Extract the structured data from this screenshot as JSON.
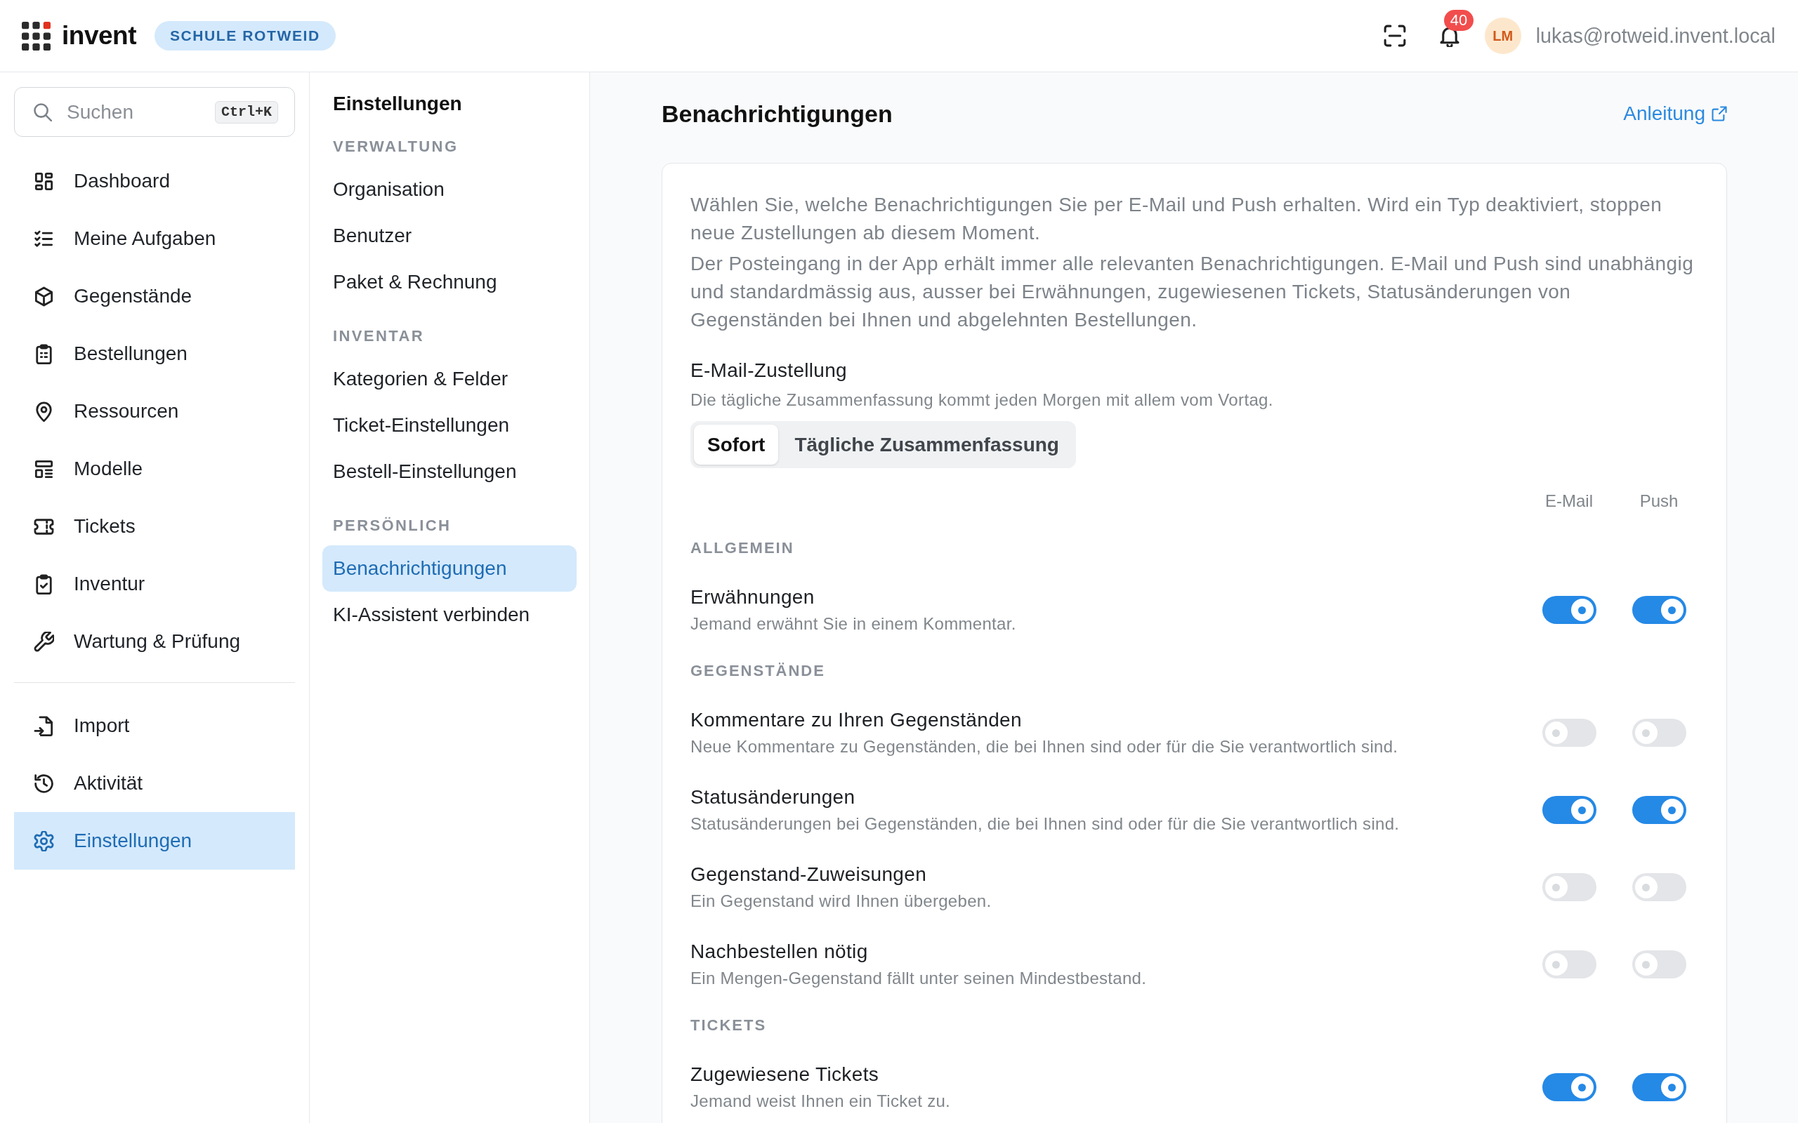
{
  "top_bar": {
    "app_name": "invent",
    "organization": "SCHULE ROTWEID",
    "notification_count": "40",
    "avatar_initials": "LM",
    "user_email": "lukas@rotweid.invent.local"
  },
  "sidebar": {
    "search": {
      "placeholder": "Suchen",
      "shortcut": "Ctrl+K"
    },
    "groups": [
      {
        "items": [
          {
            "label": "Dashboard",
            "selected": false
          },
          {
            "label": "Meine Aufgaben",
            "selected": false
          },
          {
            "label": "Gegenstände",
            "selected": false
          },
          {
            "label": "Bestellungen",
            "selected": false
          },
          {
            "label": "Ressourcen",
            "selected": false
          },
          {
            "label": "Modelle",
            "selected": false
          },
          {
            "label": "Tickets",
            "selected": false
          },
          {
            "label": "Inventur",
            "selected": false
          },
          {
            "label": "Wartung & Prüfung",
            "selected": false
          }
        ]
      },
      {
        "items": [
          {
            "label": "Import",
            "selected": false
          },
          {
            "label": "Aktivität",
            "selected": false
          },
          {
            "label": "Einstellungen",
            "selected": true
          }
        ]
      }
    ]
  },
  "settings_nav": {
    "title": "Einstellungen",
    "sections": [
      {
        "heading": "VERWALTUNG",
        "items": [
          {
            "label": "Organisation",
            "selected": false
          },
          {
            "label": "Benutzer",
            "selected": false
          },
          {
            "label": "Paket & Rechnung",
            "selected": false
          }
        ]
      },
      {
        "heading": "INVENTAR",
        "items": [
          {
            "label": "Kategorien & Felder",
            "selected": false
          },
          {
            "label": "Ticket-Einstellungen",
            "selected": false
          },
          {
            "label": "Bestell-Einstellungen",
            "selected": false
          }
        ]
      },
      {
        "heading": "PERSÖNLICH",
        "items": [
          {
            "label": "Benachrichtigungen",
            "selected": true
          },
          {
            "label": "KI-Assistent verbinden",
            "selected": false
          }
        ]
      }
    ]
  },
  "main": {
    "title": "Benachrichtigungen",
    "guide_link": "Anleitung",
    "intro": [
      "Wählen Sie, welche Benachrichtigungen Sie per E-Mail und Push erhalten. Wird ein Typ deaktiviert, stoppen neue Zustellungen ab diesem Moment.",
      "Der Posteingang in der App erhält immer alle relevanten Benachrichtigungen. E-Mail und Push sind unabhängig und standardmässig aus, ausser bei Erwähnungen, zugewiesenen Tickets, Statusänderungen von Gegenständen bei Ihnen und abgelehnten Bestellungen."
    ],
    "email_delivery": {
      "label": "E-Mail-Zustellung",
      "hint": "Die tägliche Zusammenfassung kommt jeden Morgen mit allem vom Vortag.",
      "options": [
        {
          "label": "Sofort",
          "selected": true
        },
        {
          "label": "Tägliche Zusammenfassung",
          "selected": false
        }
      ]
    },
    "columns": [
      "E-Mail",
      "Push"
    ],
    "groups": [
      {
        "heading": "ALLGEMEIN",
        "items": [
          {
            "title": "Erwähnungen",
            "description": "Jemand erwähnt Sie in einem Kommentar.",
            "email": true,
            "push": true
          }
        ]
      },
      {
        "heading": "GEGENSTÄNDE",
        "items": [
          {
            "title": "Kommentare zu Ihren Gegenständen",
            "description": "Neue Kommentare zu Gegenständen, die bei Ihnen sind oder für die Sie verantwortlich sind.",
            "email": false,
            "push": false
          },
          {
            "title": "Statusänderungen",
            "description": "Statusänderungen bei Gegenständen, die bei Ihnen sind oder für die Sie verantwortlich sind.",
            "email": true,
            "push": true
          },
          {
            "title": "Gegenstand-Zuweisungen",
            "description": "Ein Gegenstand wird Ihnen übergeben.",
            "email": false,
            "push": false
          },
          {
            "title": "Nachbestellen nötig",
            "description": "Ein Mengen-Gegenstand fällt unter seinen Mindestbestand.",
            "email": false,
            "push": false
          }
        ]
      },
      {
        "heading": "TICKETS",
        "items": [
          {
            "title": "Zugewiesene Tickets",
            "description": "Jemand weist Ihnen ein Ticket zu.",
            "email": true,
            "push": true
          }
        ]
      }
    ]
  }
}
